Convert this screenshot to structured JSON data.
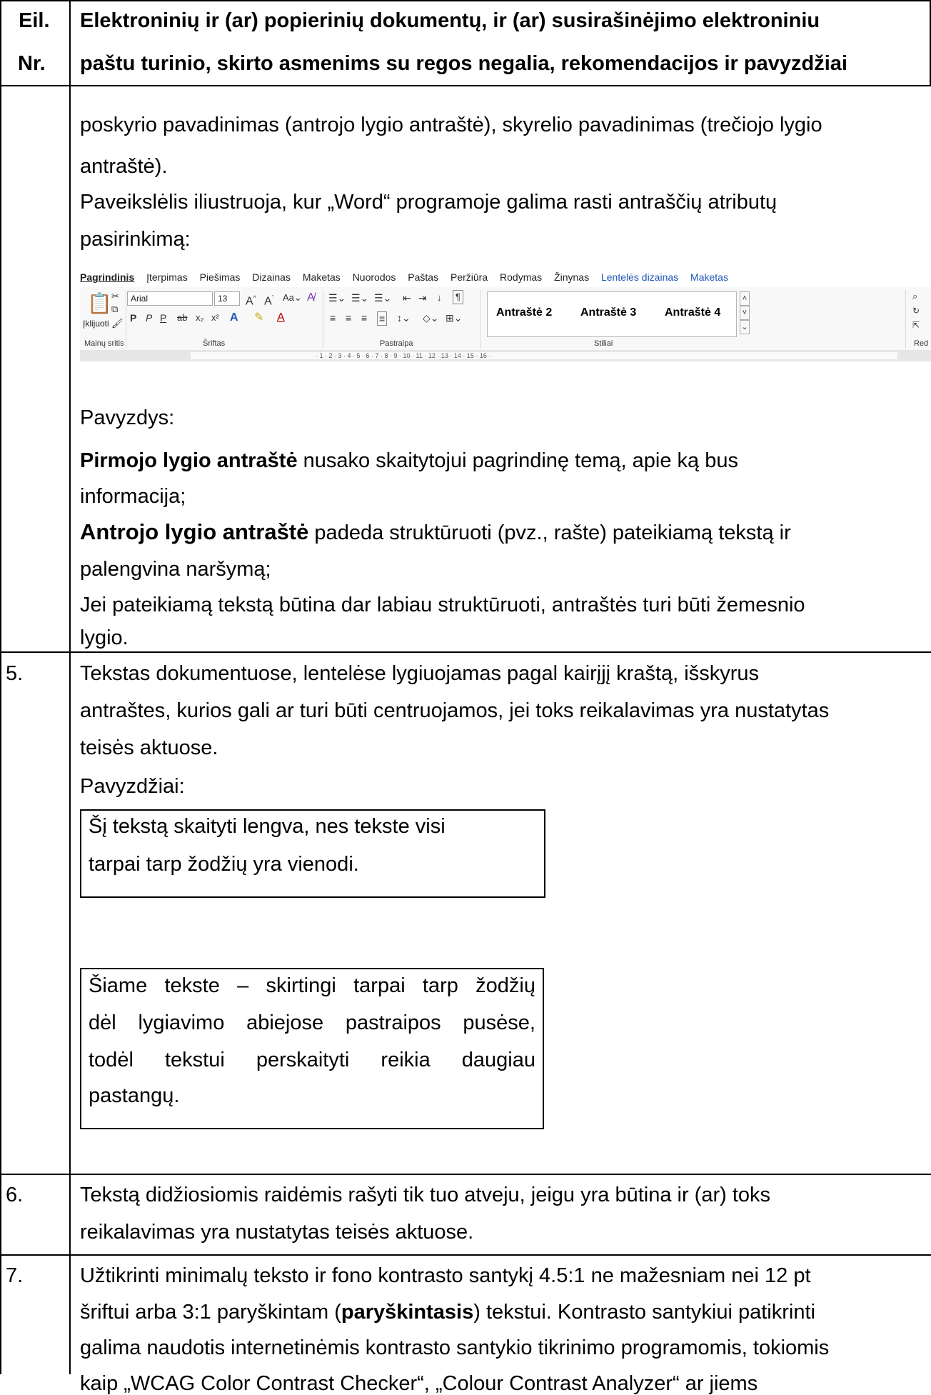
{
  "header": {
    "col1_line1": "Eil.",
    "col1_line2": "Nr.",
    "col2_line1": "Elektroninių ir (ar) popierinių dokumentų, ir (ar) susirašinėjimo elektroniniu",
    "col2_line2": "paštu turinio, skirto asmenims su regos negalia, rekomendacijos ir pavyzdžiai"
  },
  "row_cont": {
    "line1": "poskyrio pavadinimas (antrojo lygio antraštė), skyrelio pavadinimas (trečiojo lygio",
    "line2": "antraštė).",
    "line3": "Paveikslėlis iliustruoja, kur „Word“ programoje galima rasti antraščių atributų",
    "line4": "pasirinkimą:",
    "example_label": "Pavyzdys:",
    "h1_bold": "Pirmojo lygio antraštė",
    "h1_rest": " nusako skaitytojui pagrindinę temą, apie ką bus",
    "h1_line2": "informacija;",
    "h2_bold": "Antrojo lygio antraštė",
    "h2_rest": " padeda struktūruoti (pvz., rašte) pateikiamą tekstą ir",
    "h2_line2": "palengvina naršymą;",
    "h3_line1": "Jei pateikiamą tekstą būtina dar labiau struktūruoti, antraštės turi būti žemesnio",
    "h3_line2": "lygio."
  },
  "ribbon": {
    "tabs": [
      "Pagrindinis",
      "Įterpimas",
      "Piešimas",
      "Dizainas",
      "Maketas",
      "Nuorodos",
      "Paštas",
      "Peržiūra",
      "Rodymas",
      "Žinynas"
    ],
    "context_tabs": [
      "Lentelės dizainas",
      "Maketas"
    ],
    "paste_label": "Įklijuoti",
    "font_name": "Arial",
    "font_size": "13",
    "group_labels": [
      "Mainų sritis",
      "Šriftas",
      "Pastraipa",
      "Stiliai",
      "Red"
    ],
    "styles": [
      "Antraštė 2",
      "Antraštė 3",
      "Antraštė 4"
    ],
    "ruler_text": "· 1 · 2 · 3 · 4 · 5 · 6 · 7 · 8 · 9 · 10 · 11 · 12 · 13 · 14 · 15 · 16 ·"
  },
  "row5": {
    "num": "5.",
    "line1": "Tekstas dokumentuose, lentelėse lygiuojamas pagal kairįjį kraštą, išskyrus",
    "line2": "antraštes, kurios gali ar turi būti centruojamos, jei toks reikalavimas yra nustatytas",
    "line3": "teisės aktuose.",
    "examples_label": "Pavyzdžiai:",
    "box1_line1": "Šį tekstą skaityti lengva, nes tekste visi",
    "box1_line2": "tarpai tarp žodžių yra vienodi.",
    "box2_line1": "Šiame tekste – skirtingi tarpai tarp žodžių",
    "box2_line2": "dėl lygiavimo abiejose pastraipos pusėse,",
    "box2_line3": "todėl tekstui perskaityti reikia daugiau",
    "box2_line4": "pastangų."
  },
  "row6": {
    "num": "6.",
    "line1": "Tekstą didžiosiomis raidėmis rašyti tik tuo atveju, jeigu yra būtina ir (ar) toks",
    "line2": "reikalavimas yra nustatytas teisės aktuose."
  },
  "row7": {
    "num": "7.",
    "line1": "Užtikrinti minimalų teksto ir fono kontrasto santykį 4.5:1 ne mažesniam nei 12 pt",
    "line2_pre": "šriftui arba 3:1 paryškintam (",
    "line2_bold": "paryškintasis",
    "line2_post": ") tekstui. Kontrasto santykiui patikrinti",
    "line3": "galima naudotis internetinėmis kontrasto santykio tikrinimo programomis, tokiomis",
    "line4": "kaip „WCAG Color Contrast Checker“, „Colour Contrast Analyzer“ ar jiems"
  }
}
